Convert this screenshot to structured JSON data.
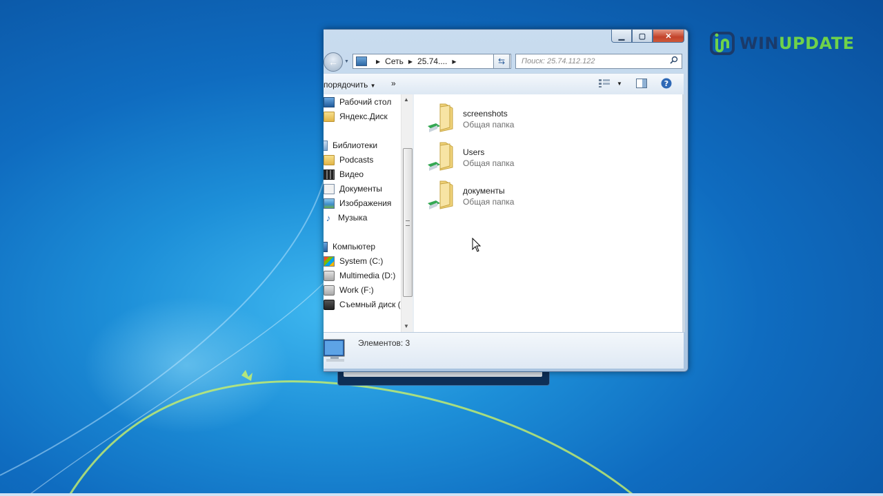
{
  "watermark": {
    "brand_part1": "WIN",
    "brand_part2": "UPDATE",
    "accent": "#6fd24a",
    "dark": "#1a3a6a"
  },
  "window": {
    "caption_buttons": [
      "minimize-icon",
      "maximize-icon",
      "close-icon"
    ],
    "address": {
      "crumbs": [
        "Сеть",
        "25.74...."
      ]
    },
    "search_placeholder": "Поиск: 25.74.112.122",
    "toolbar": {
      "organize_label": "порядочить",
      "more_label": "»"
    }
  },
  "nav": {
    "items": [
      {
        "label": "Рабочий стол",
        "icon": "desktop-icon"
      },
      {
        "label": "Яндекс.Диск",
        "icon": "folder-icon"
      },
      {
        "label": "Библиотеки",
        "icon": "libraries-icon"
      },
      {
        "label": "Podcasts",
        "icon": "folder-icon"
      },
      {
        "label": "Видео",
        "icon": "video-icon"
      },
      {
        "label": "Документы",
        "icon": "documents-icon"
      },
      {
        "label": "Изображения",
        "icon": "pictures-icon"
      },
      {
        "label": "Музыка",
        "icon": "music-icon"
      },
      {
        "label": "Компьютер",
        "icon": "computer-icon"
      },
      {
        "label": "System (C:)",
        "icon": "system-drive-icon"
      },
      {
        "label": "Multimedia (D:)",
        "icon": "hdd-icon"
      },
      {
        "label": "Work (F:)",
        "icon": "hdd-icon"
      },
      {
        "label": "Съемный диск (",
        "icon": "removable-drive-icon"
      }
    ]
  },
  "files": [
    {
      "name": "screenshots",
      "type": "Общая папка"
    },
    {
      "name": "Users",
      "type": "Общая папка"
    },
    {
      "name": "документы",
      "type": "Общая папка"
    }
  ],
  "status": {
    "count": "Элементов: 3"
  }
}
